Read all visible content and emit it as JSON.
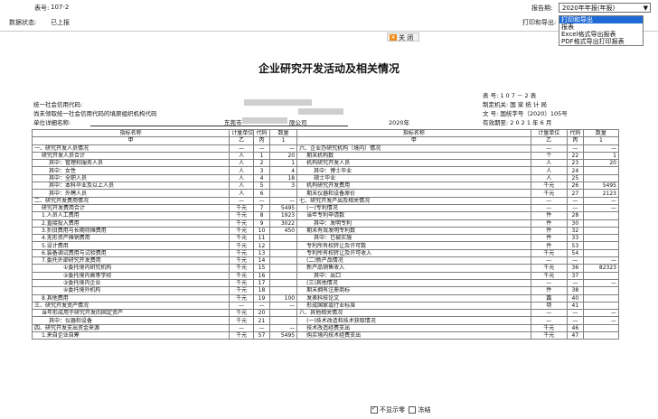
{
  "topbar": {
    "table_no_label": "表号:",
    "table_no_value": "107-2",
    "status_label": "数据状态:",
    "status_value": "已上报",
    "report_period_label": "报告期:",
    "report_period_value": "2020年年报(年报)",
    "print_export_label": "打印和导出:",
    "print_options": [
      "打印和导出",
      "报表",
      "Excel格式导出报表",
      "PDF格式导出打印报表"
    ],
    "close_label": "关 闭"
  },
  "report": {
    "title": "企业研究开发活动及相关情况",
    "table_no": "表    号: 1 0 7 － 2  表",
    "authority": "制定机关: 国 家 统 计 局",
    "doc_no": "文    号: 国统字号（2020）105号",
    "valid_until": "有效期至: 2 0 2 1 年 6 月",
    "credit_code_label": "统一社会信用代码:",
    "org_code_label": "尚未领取统一社会信用代码的填原组织机构代码",
    "unit_name_label": "单位详细名称:",
    "unit_name_value_left": "东莞市",
    "unit_name_value_right": "限公司",
    "year": "2020年"
  },
  "table": {
    "header1": [
      "指标名称",
      "计量单位",
      "代码",
      "数量",
      "指标名称",
      "计量单位",
      "代码",
      "数量"
    ],
    "header2": [
      "甲",
      "乙",
      "丙",
      "1",
      "甲",
      "乙",
      "丙",
      "1"
    ],
    "rows": [
      [
        "一、研究开发人员情况",
        "—",
        "—",
        "—",
        "六、企业办研究机构（境内）情况",
        "—",
        "—",
        "—"
      ],
      [
        "研究开发人员合计",
        "人",
        "1",
        "20",
        "期末机构数",
        "个",
        "22",
        "1"
      ],
      [
        "其中：管理和服务人员",
        "人",
        "2",
        "1",
        "机构研究开发人员",
        "人",
        "23",
        "20"
      ],
      [
        "其中：女性",
        "人",
        "3",
        "4",
        "其中：博士毕业",
        "人",
        "24",
        ""
      ],
      [
        "其中：全职人员",
        "人",
        "4",
        "18",
        "硕士毕业",
        "人",
        "25",
        ""
      ],
      [
        "其中：本科毕业及以上人员",
        "人",
        "5",
        "3",
        "机构研究开发费用",
        "千元",
        "26",
        "5495"
      ],
      [
        "其中：外聘人员",
        "人",
        "6",
        "",
        "期末仪器和设备原价",
        "千元",
        "27",
        "2123"
      ],
      [
        "二、研究开发费用情况",
        "—",
        "—",
        "—",
        "七、研究开发产出及相关情况",
        "—",
        "—",
        "—"
      ],
      [
        "研究开发费用合计",
        "千元",
        "7",
        "5495",
        "(一)专利情况",
        "—",
        "—",
        "—"
      ],
      [
        "1.人员人工费用",
        "千元",
        "8",
        "1923",
        "当年专利申请数",
        "件",
        "28",
        ""
      ],
      [
        "2.直接投入费用",
        "千元",
        "9",
        "3022",
        "其中：发明专利",
        "件",
        "30",
        ""
      ],
      [
        "3.折旧费用与长期待摊费用",
        "千元",
        "10",
        "450",
        "期末有效发明专利数",
        "件",
        "32",
        ""
      ],
      [
        "4.无形资产摊销费用",
        "千元",
        "11",
        "",
        "其中：已被实施",
        "件",
        "33",
        ""
      ],
      [
        "5.设计费用",
        "千元",
        "12",
        "",
        "专利所有权转让及许可数",
        "件",
        "53",
        ""
      ],
      [
        "6.装备调试费用与试验费用",
        "千元",
        "13",
        "",
        "专利所有权转让及许可收入",
        "千元",
        "54",
        ""
      ],
      [
        "7.委托外部研究开发费用",
        "千元",
        "14",
        "",
        "(二)新产品情况",
        "—",
        "—",
        "—"
      ],
      [
        "①委托境内研究机构",
        "千元",
        "15",
        "",
        "新产品销售收入",
        "千元",
        "36",
        "82323"
      ],
      [
        "②委托境内高等学校",
        "千元",
        "16",
        "",
        "其中：出口",
        "千元",
        "37",
        ""
      ],
      [
        "③委托境内企业",
        "千元",
        "17",
        "",
        "(三)其他情况",
        "—",
        "—",
        "—"
      ],
      [
        "④委托境外机构",
        "千元",
        "18",
        "",
        "期末拥有注册商标",
        "件",
        "38",
        ""
      ],
      [
        "8.其他费用",
        "千元",
        "19",
        "100",
        "发表科技论文",
        "篇",
        "40",
        ""
      ],
      [
        "三、研究开发资产情况",
        "—",
        "—",
        "—",
        "形成国家或行业标准",
        "项",
        "41",
        ""
      ],
      [
        "当年形成用于研究开发的固定资产",
        "千元",
        "20",
        "",
        "八、其他相关情况",
        "—",
        "—",
        "—"
      ],
      [
        "其中：仪器和设备",
        "千元",
        "21",
        "",
        "(一)技术改造和技术获取情况",
        "—",
        "—",
        "—"
      ],
      [
        "四、研究开发支出资金来源",
        "—",
        "—",
        "—",
        "技术改造经费支出",
        "千元",
        "46",
        ""
      ],
      [
        "1.来自企业自筹",
        "千元",
        "57",
        "5495",
        "购买境内技术经费支出",
        "千元",
        "47",
        ""
      ]
    ]
  },
  "footer": {
    "hide_zero_label": "不显示零",
    "freeze_label": "冻结"
  }
}
